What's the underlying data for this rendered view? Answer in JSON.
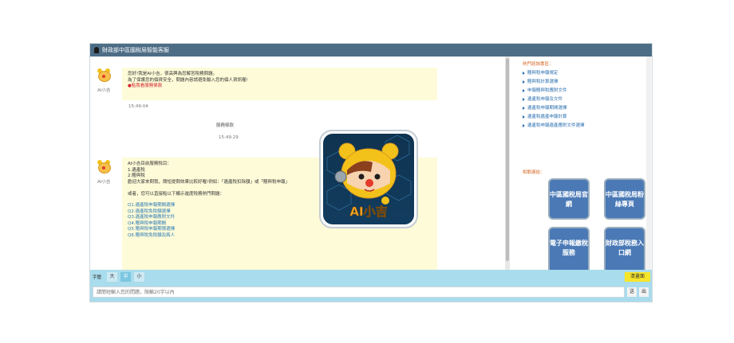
{
  "window": {
    "title": "財政部中區國稅局智能客服"
  },
  "chat": {
    "msg1": {
      "bot_name": "AI小吉",
      "lines": [
        "您好!我是AI小吉，很高興為您解答稅務問題。",
        "為了保護您的個資安全，問題內容請避免輸入您的個人資訊喔!"
      ],
      "link": "●點我看服務條款",
      "time": "15:49:04"
    },
    "user1": {
      "text": "服務條款",
      "time": "15:49:29"
    },
    "msg2": {
      "bot_name": "AI小吉",
      "lines": [
        "AI小吉目前服務稅目：",
        "1.遺產稅",
        "2.贈與稅",
        "歡迎大家來問我，簡短提問效果比較好喔!例如：「遺產稅扣除額」或「贈與稅申報」",
        "",
        "或者，您可以直接點以下顯示進度稅務熱門問題："
      ],
      "links": [
        "Q1.遺產稅申報期間選擇",
        "Q2.遺產稅免稅額選擇",
        "Q3.遺產稅申報應附文件",
        "Q4.贈與稅申報期間",
        "Q5.贈與稅申報期限選擇",
        "Q6.贈與稅免稅額及兩人"
      ]
    }
  },
  "sidebar": {
    "hot_title": "熱門諮詢專區：",
    "hot_items": [
      "贈與稅申報規定",
      "贈與稅計算選擇",
      "申報贈與稅應附文件",
      "遺產稅申報及文件",
      "遺產稅申報期間選擇",
      "遺產稅遺產申報計算",
      "遺產稅申報遺產應附文件選擇"
    ],
    "links_title": "相關連結：",
    "tiles": [
      "中區國稅局官網",
      "中區國稅局粉絲專頁",
      "電子申報繳稅服務",
      "財政部稅務入口網"
    ]
  },
  "fontbar": {
    "label": "字體",
    "sizes": [
      "大",
      "中",
      "小"
    ],
    "clear": "清畫面"
  },
  "input": {
    "placeholder": "請簡短輸入您的問題，限輸20字以內",
    "send": "送",
    "mic": "出"
  },
  "overlay": {
    "logo_text": "AI小吉"
  },
  "colors": {
    "titlebar": "#4d6d86",
    "bubble": "#fdfbd8",
    "toolbar": "#a9dcec",
    "tile": "#4a79b6",
    "clear": "#f7e52a"
  }
}
